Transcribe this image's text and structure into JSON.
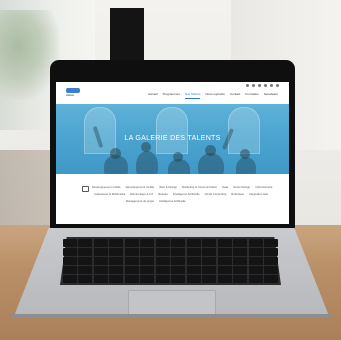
{
  "screen": {
    "logo_text": "Aldea",
    "menu": [
      "Accueil",
      "Programmes",
      "Nos Talents",
      "Nous rejoindre",
      "Contact",
      "Formation",
      "Newsletter"
    ],
    "hero_title": "LA GALERIE DES TALENTS",
    "categories_row1": [
      "Développement mobile",
      "Développement mobile",
      "Web & Design",
      "Marketing & Communication",
      "Data",
      "Game Design",
      "Cybersécurité"
    ],
    "categories_row2": [
      "Audiovisuel & Multimédia",
      "Electronique & IoT",
      "Réseau",
      "Intelligence Artificielle",
      "Cloud Computing",
      "Robotique",
      "Intégration web"
    ],
    "categories_row3": [
      "Management de projet",
      "Intelligence Artificielle"
    ]
  },
  "colors": {
    "hero": "#4aa4cf",
    "accent": "#2a7ad0"
  }
}
